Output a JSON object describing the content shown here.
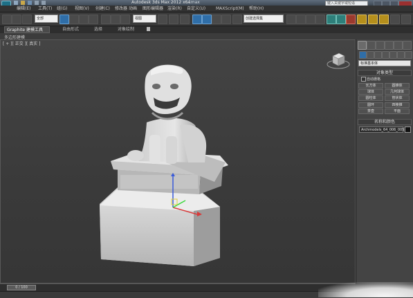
{
  "titlebar": {
    "app_title": "Autodesk 3ds Max 2012 x64",
    "file_name": "...max",
    "search_placeholder": "键入关键字或短语"
  },
  "menu": [
    "编辑(E)",
    "工具(T)",
    "组(G)",
    "视图(V)",
    "创建(C)",
    "修改器",
    "动画",
    "图形编辑器",
    "渲染(R)",
    "自定义(U)",
    "MAXScript(M)",
    "帮助(H)"
  ],
  "toolbar": {
    "selection_filter": "全部",
    "ref_coord": "视图",
    "named_selection": "创建选择集"
  },
  "ribbon": {
    "tabs": [
      "Graphite 建模工具",
      "自由形式",
      "选择",
      "对象绘制"
    ],
    "sub_label": "多边形建模"
  },
  "viewport": {
    "label": "[ + ][ 正交 ][ 真实 ]"
  },
  "command_panel": {
    "category": "标准基本体",
    "object_type_title": "对象类型",
    "autogrid": "自动栅格",
    "objects": [
      "长方体",
      "圆锥体",
      "球体",
      "几何球体",
      "圆柱体",
      "管状体",
      "圆环",
      "四棱锥",
      "茶壶",
      "平面"
    ],
    "name_color_title": "名称和颜色",
    "object_name": "Archmodels_64_006_005"
  },
  "timeline": {
    "frame": "0 / 100"
  },
  "colors": {
    "viewport_bg": "#3e3e3e",
    "panel_bg": "#444444",
    "active_icon": "#2f6ea8"
  }
}
